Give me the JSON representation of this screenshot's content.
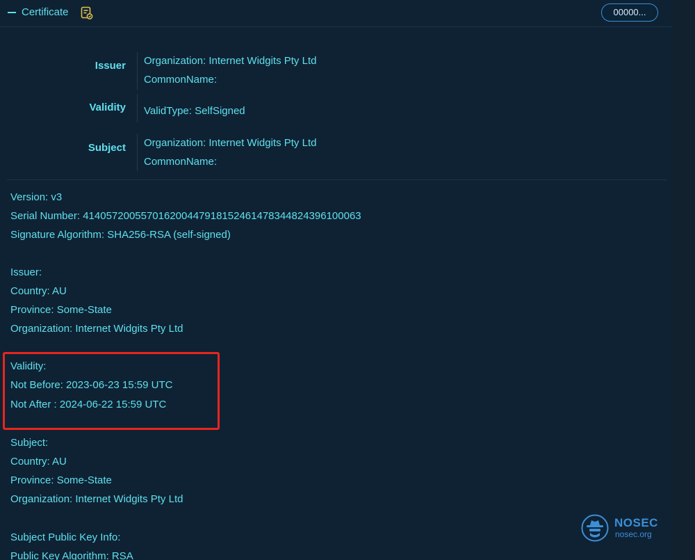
{
  "header": {
    "title": "Certificate",
    "pill_label": "00000..."
  },
  "summary": {
    "issuer": {
      "label": "Issuer",
      "lines": [
        "Organization:  Internet Widgits Pty Ltd",
        "CommonName:"
      ]
    },
    "validity": {
      "label": "Validity",
      "lines": [
        "ValidType:  SelfSigned"
      ]
    },
    "subject": {
      "label": "Subject",
      "lines": [
        "Organization:  Internet Widgits Pty Ltd",
        "CommonName:"
      ]
    }
  },
  "details": {
    "version": "Version: v3",
    "serial": "Serial Number: 414057200557016200447918152461478344824396100063",
    "sig_alg": "Signature Algorithm: SHA256-RSA (self-signed)",
    "issuer_heading": "Issuer:",
    "issuer_country": "Country: AU",
    "issuer_province": "Province: Some-State",
    "issuer_org": "Organization: Internet Widgits Pty Ltd",
    "validity_heading": "Validity:",
    "not_before": "Not Before: 2023-06-23 15:59 UTC",
    "not_after": "Not After : 2024-06-22 15:59 UTC",
    "subject_heading": "Subject:",
    "subject_country": "Country: AU",
    "subject_province": "Province: Some-State",
    "subject_org": "Organization: Internet Widgits Pty Ltd",
    "spki_heading": "Subject Public Key Info:",
    "pk_alg": "Public Key Algorithm: RSA"
  },
  "logo": {
    "name": "NOSEC",
    "url": "nosec.org"
  },
  "colors": {
    "background": "#0f2233",
    "text": "#5fe0ee",
    "highlight": "#e8251e",
    "pill_border": "#3d8fd6",
    "logo": "#3b8fd8"
  },
  "icons": {
    "collapse": "minus-icon",
    "certificate": "certificate-icon",
    "logo": "spy-hat-icon"
  }
}
